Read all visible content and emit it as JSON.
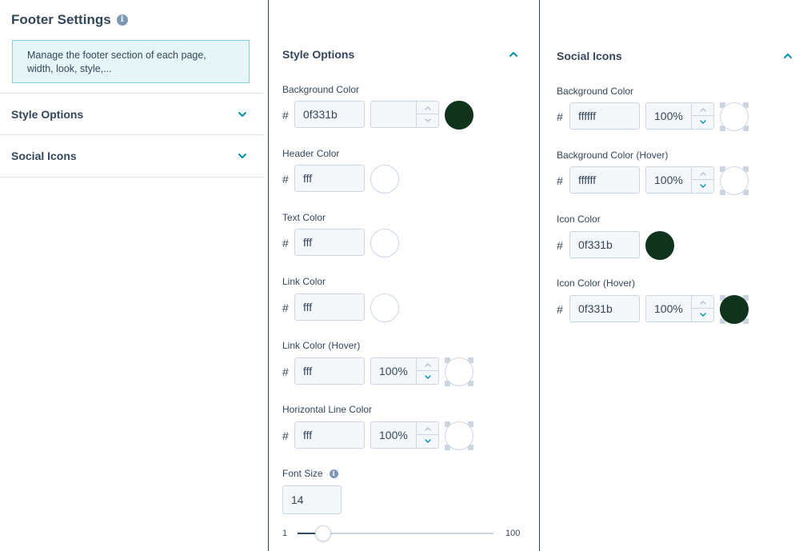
{
  "settings": {
    "title": "Footer Settings",
    "info_icon": "i",
    "description": "Manage the footer section of each page, width, look, style,...",
    "sections": [
      {
        "label": "Style Options"
      },
      {
        "label": "Social Icons"
      }
    ]
  },
  "style_options": {
    "heading": "Style Options",
    "hash": "#",
    "background_color": {
      "label": "Background Color",
      "hex": "0f331b",
      "opacity": ""
    },
    "header_color": {
      "label": "Header Color",
      "hex": "fff"
    },
    "text_color": {
      "label": "Text Color",
      "hex": "fff"
    },
    "link_color": {
      "label": "Link Color",
      "hex": "fff"
    },
    "link_color_hover": {
      "label": "Link Color (Hover)",
      "hex": "fff",
      "opacity": "100%"
    },
    "horizontal_line_color": {
      "label": "Horizontal Line Color",
      "hex": "fff",
      "opacity": "100%"
    },
    "font_size": {
      "label": "Font Size",
      "value": "14",
      "min": "1",
      "max": "100",
      "level": 14
    }
  },
  "social_icons": {
    "heading": "Social Icons",
    "hash": "#",
    "background_color": {
      "label": "Background Color",
      "hex": "ffffff",
      "opacity": "100%"
    },
    "background_color_hover": {
      "label": "Background Color (Hover)",
      "hex": "ffffff",
      "opacity": "100%"
    },
    "icon_color": {
      "label": "Icon Color",
      "hex": "0f331b"
    },
    "icon_color_hover": {
      "label": "Icon Color (Hover)",
      "hex": "0f331b",
      "opacity": "100%"
    }
  },
  "colors": {
    "dark_green": "#0f331b",
    "accent": "#0091ae",
    "text": "#33475b",
    "info_blue_bg": "#e5f5f8"
  },
  "icons": [
    "info-icon",
    "chevron-down-icon",
    "chevron-up-icon",
    "chevron-small-up-icon",
    "chevron-small-down-icon"
  ]
}
